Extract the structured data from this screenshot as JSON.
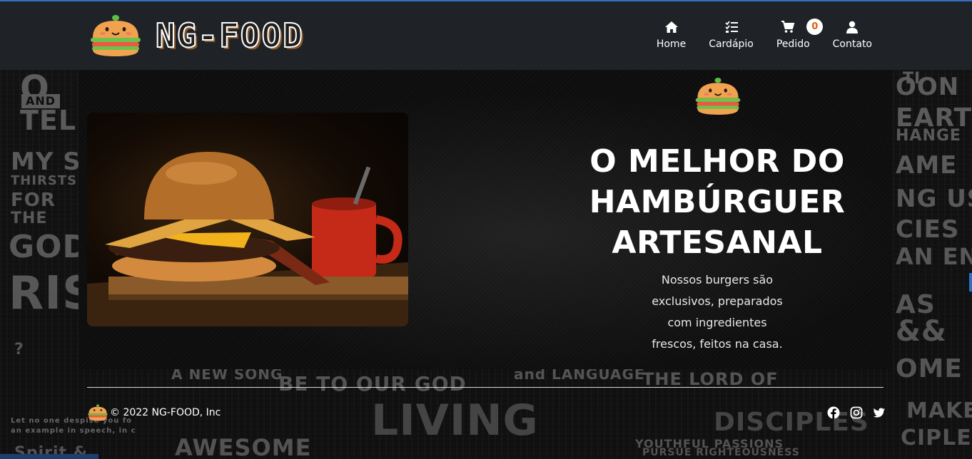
{
  "brand": {
    "name": "NG-FOOD",
    "logo_icon": "burger-mascot-icon"
  },
  "nav": {
    "items": [
      {
        "label": "Home",
        "icon": "home-icon"
      },
      {
        "label": "Cardápio",
        "icon": "checklist-icon"
      },
      {
        "label": "Pedido",
        "icon": "cart-icon",
        "badge": "0"
      },
      {
        "label": "Contato",
        "icon": "user-icon"
      }
    ]
  },
  "hero": {
    "title_line1": "O MELHOR DO",
    "title_line2": "HAMBÚRGUER",
    "title_line3": "ARTESANAL",
    "text_line1": "Nossos burgers são",
    "text_line2": "exclusivos, preparados",
    "text_line3": "com ingredientes",
    "text_line4": "frescos, feitos na casa."
  },
  "footer": {
    "copyright": "© 2022 NG-FOOD, Inc",
    "social": [
      "facebook-icon",
      "instagram-icon",
      "twitter-icon"
    ]
  },
  "colors": {
    "navbar_bg": "#1f2227",
    "badge_text": "#e0620e",
    "accent_blue": "#2f6fc4"
  }
}
